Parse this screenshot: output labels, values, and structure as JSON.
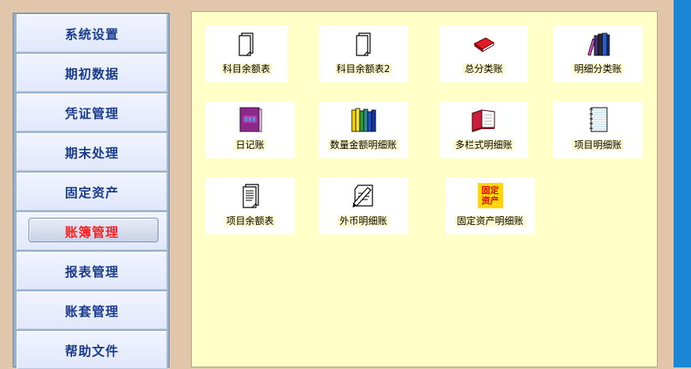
{
  "sidebar": {
    "items": [
      {
        "label": "系统设置"
      },
      {
        "label": "期初数据"
      },
      {
        "label": "凭证管理"
      },
      {
        "label": "期末处理"
      },
      {
        "label": "固定资产"
      },
      {
        "label": "账簿管理",
        "active": true
      },
      {
        "label": "报表管理"
      },
      {
        "label": "账套管理"
      },
      {
        "label": "帮助文件"
      }
    ]
  },
  "tiles": [
    {
      "label": "科目余额表",
      "icon": "document-icon"
    },
    {
      "label": "科目余额表2",
      "icon": "document-icon"
    },
    {
      "label": "总分类账",
      "icon": "red-book-icon"
    },
    {
      "label": "明细分类账",
      "icon": "books-icon"
    },
    {
      "label": "日记账",
      "icon": "purple-book-icon"
    },
    {
      "label": "数量金额明细账",
      "icon": "colored-books-icon"
    },
    {
      "label": "多栏式明细账",
      "icon": "open-book-icon"
    },
    {
      "label": "项目明细账",
      "icon": "notepad-icon"
    },
    {
      "label": "项目余额表",
      "icon": "text-document-icon"
    },
    {
      "label": "外币明细账",
      "icon": "writing-icon"
    },
    {
      "label": "固定资产明细账",
      "icon": "fixed-asset-icon",
      "icon_text": [
        "固定",
        "资产"
      ]
    }
  ],
  "colors": {
    "nav_text": "#1a3c8c",
    "nav_active_text": "#ff2020",
    "content_bg": "#ffffc8",
    "frame_bg": "#e2c6ab",
    "accent_blue": "#1c86d6"
  }
}
